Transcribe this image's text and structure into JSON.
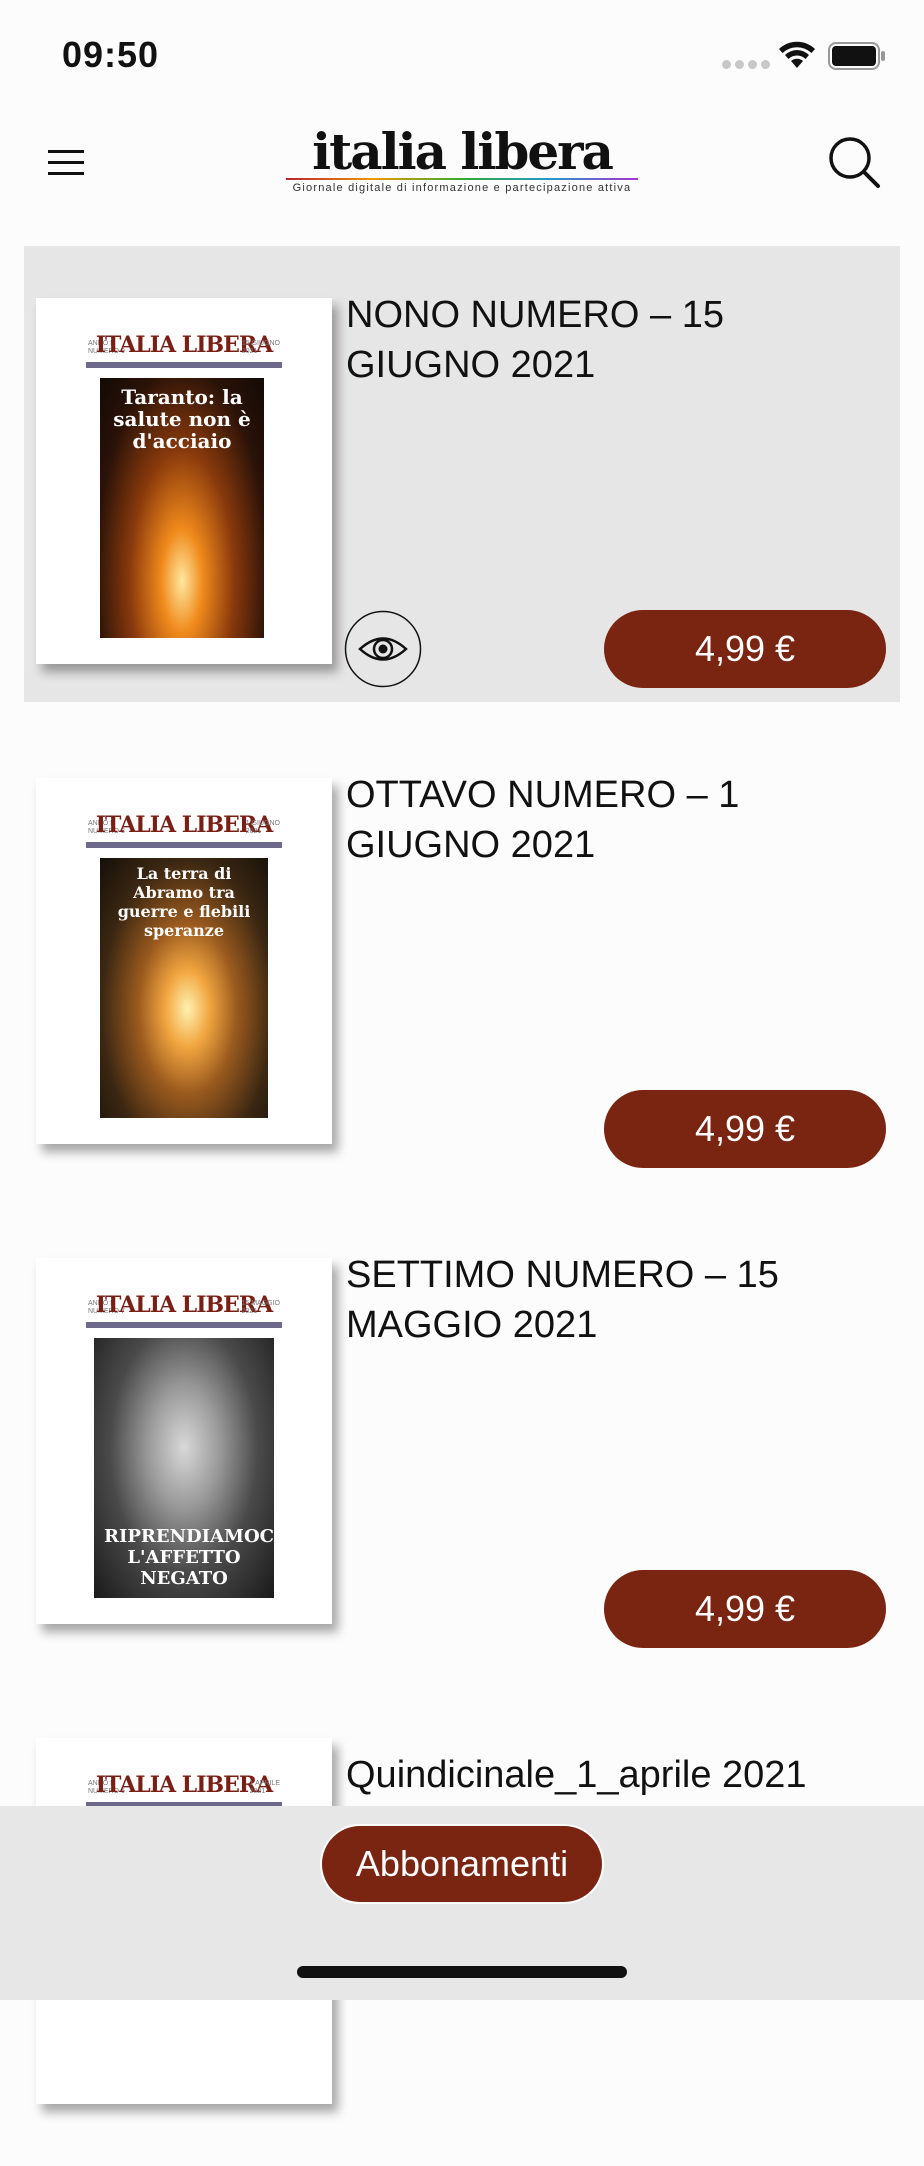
{
  "status_bar": {
    "time": "09:50"
  },
  "header": {
    "logo_title": "italia libera",
    "logo_tagline": "Giornale digitale di informazione e partecipazione attiva"
  },
  "issues": [
    {
      "title": "NONO NUMERO – 15 GIUGNO 2021",
      "price": "4,99 €",
      "cover": {
        "masthead": "ITALIA LIBERA",
        "headline": "Taranto: la salute non è d'acciaio"
      }
    },
    {
      "title": "OTTAVO NUMERO – 1 GIUGNO 2021",
      "price": "4,99 €",
      "cover": {
        "masthead": "ITALIA LIBERA",
        "headline": "La terra di Abramo tra guerre e flebili speranze"
      }
    },
    {
      "title": "SETTIMO NUMERO – 15 MAGGIO 2021",
      "price": "4,99 €",
      "cover": {
        "masthead": "ITALIA LIBERA",
        "headline": "RIPRENDIAMOCI L'AFFETTO NEGATO"
      }
    },
    {
      "title": "Quindicinale_1_aprile 2021",
      "cover": {
        "masthead": "ITALIA LIBERA"
      }
    }
  ],
  "bottom_bar": {
    "subscribe_label": "Abbonamenti"
  },
  "icons": [
    "menu-icon",
    "search-icon",
    "eye-icon",
    "wifi-icon",
    "battery-icon",
    "signal-icon"
  ],
  "colors": {
    "accent": "#7a2412",
    "selected_row": "#e7e6e6",
    "bottom_bar": "#e8e7e7"
  }
}
